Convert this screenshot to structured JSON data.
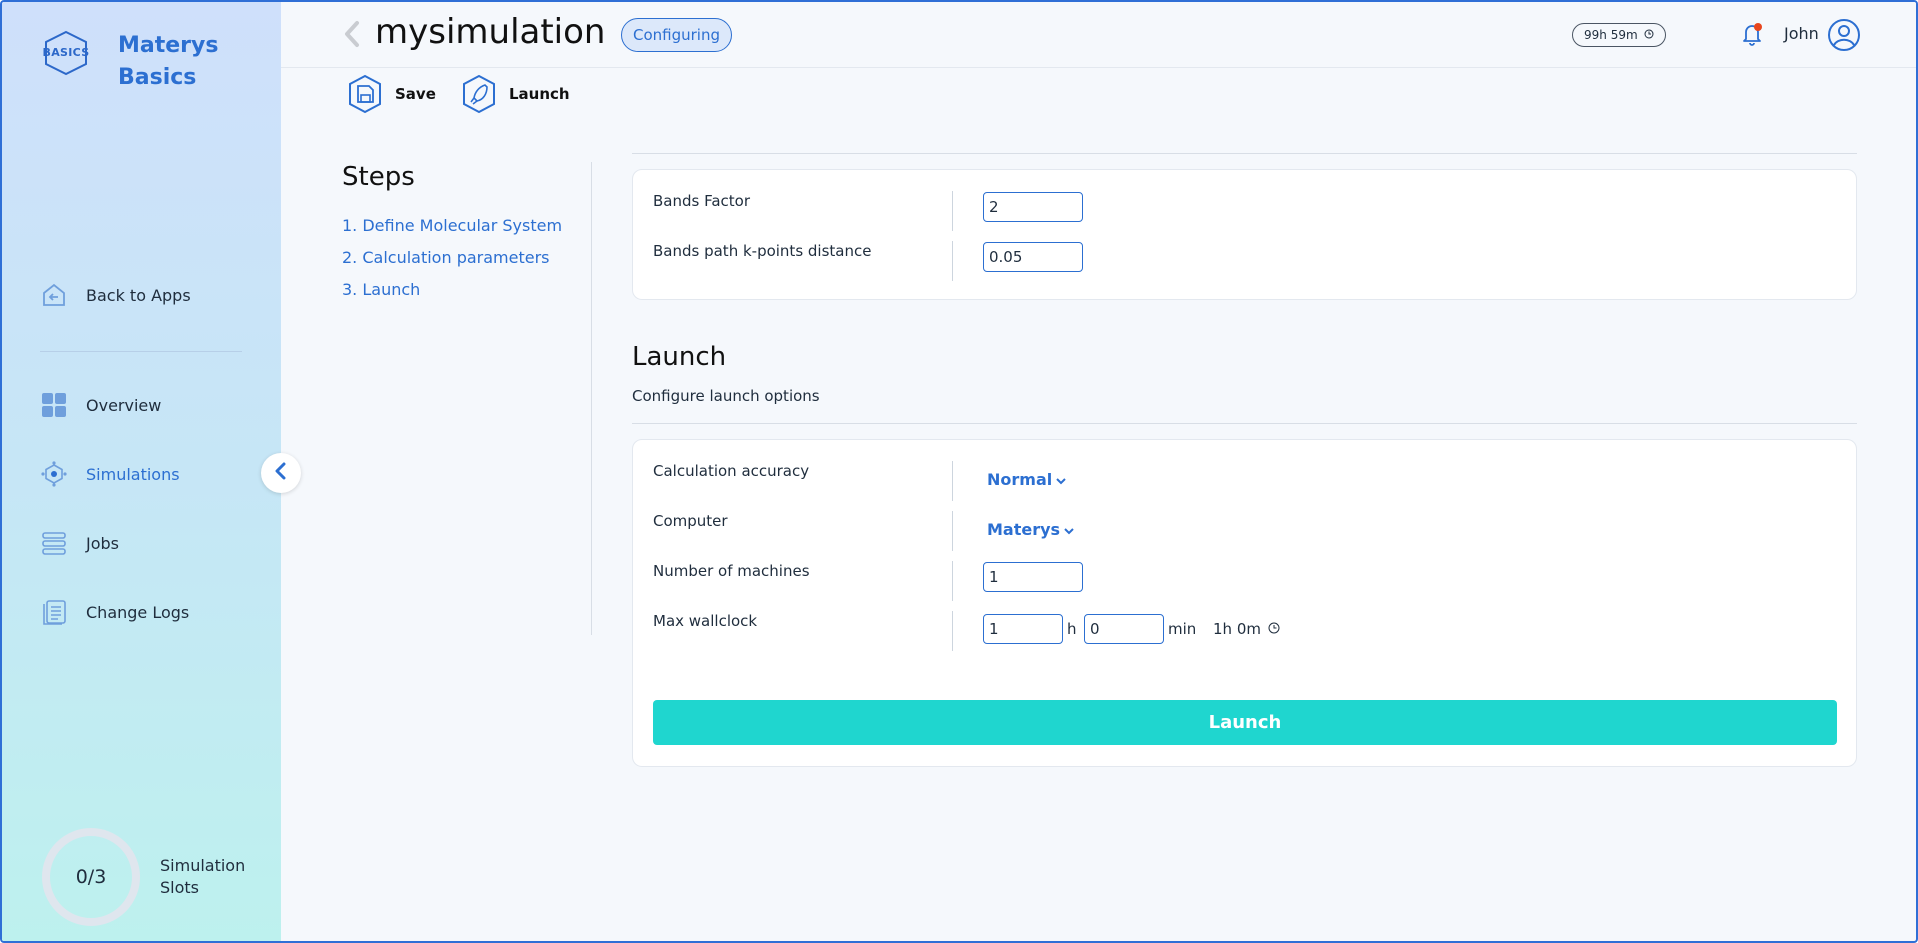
{
  "app": {
    "name": "Materys Basics",
    "logo_text": "BASICS"
  },
  "sidebar": {
    "items": [
      {
        "label": "Back to Apps",
        "icon": "back-to-apps-icon"
      },
      {
        "label": "Overview",
        "icon": "grid-icon"
      },
      {
        "label": "Simulations",
        "icon": "simulations-icon",
        "active": true
      },
      {
        "label": "Jobs",
        "icon": "stack-icon"
      },
      {
        "label": "Change Logs",
        "icon": "logs-icon"
      }
    ],
    "slots": {
      "value": "0/3",
      "label": "Simulation Slots"
    }
  },
  "header": {
    "title": "mysimulation",
    "status": "Configuring",
    "time_remaining": "99h 59m",
    "user": "John"
  },
  "toolbar": {
    "save_label": "Save",
    "launch_label": "Launch"
  },
  "steps": {
    "title": "Steps",
    "items": [
      "1. Define Molecular System",
      "2. Calculation parameters",
      "3. Launch"
    ]
  },
  "bands": {
    "bands_factor_label": "Bands Factor",
    "bands_factor_value": "2",
    "kpoints_label": "Bands path k-points distance",
    "kpoints_value": "0.05"
  },
  "launch": {
    "title": "Launch",
    "subtitle": "Configure launch options",
    "accuracy_label": "Calculation accuracy",
    "accuracy_value": "Normal",
    "computer_label": "Computer",
    "computer_value": "Materys",
    "machines_label": "Number of machines",
    "machines_value": "1",
    "wallclock_label": "Max wallclock",
    "wallclock_hours": "1",
    "hours_unit": "h",
    "wallclock_minutes": "0",
    "minutes_unit": "min",
    "wallclock_summary": "1h 0m",
    "button_label": "Launch"
  },
  "colors": {
    "accent": "#2c6fd1",
    "launch_button": "#1fd6cf",
    "notification_dot": "#e8461e"
  }
}
